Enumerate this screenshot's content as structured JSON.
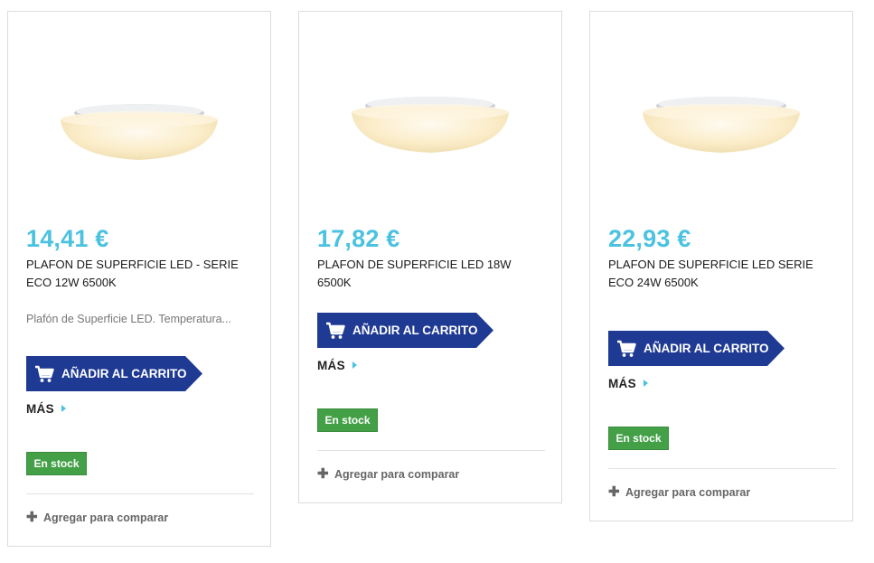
{
  "products": [
    {
      "price": "14,41 €",
      "title": "PLAFON DE SUPERFICIE LED - SERIE ECO 12W 6500K",
      "description": "Plafón de Superficie LED. Temperatura...",
      "cart_label": "AÑADIR AL CARRITO",
      "more_label": "MÁS",
      "stock_label": "En stock",
      "compare_label": "Agregar para comparar"
    },
    {
      "price": "17,82 €",
      "title": "PLAFON DE SUPERFICIE LED 18W 6500K",
      "description": "",
      "cart_label": "AÑADIR AL CARRITO",
      "more_label": "MÁS",
      "stock_label": "En stock",
      "compare_label": "Agregar para comparar"
    },
    {
      "price": "22,93 €",
      "title": "PLAFON DE SUPERFICIE LED SERIE ECO 24W 6500K",
      "description": "",
      "cart_label": "AÑADIR AL CARRITO",
      "more_label": "MÁS",
      "stock_label": "En stock",
      "compare_label": "Agregar para comparar"
    }
  ],
  "icons": {
    "cart": "shopping-cart-icon",
    "more": "caret-right-icon",
    "compare": "plus-icon"
  },
  "colors": {
    "price": "#4bc2e0",
    "cart_button": "#1f3a93",
    "stock_badge": "#43a047"
  }
}
